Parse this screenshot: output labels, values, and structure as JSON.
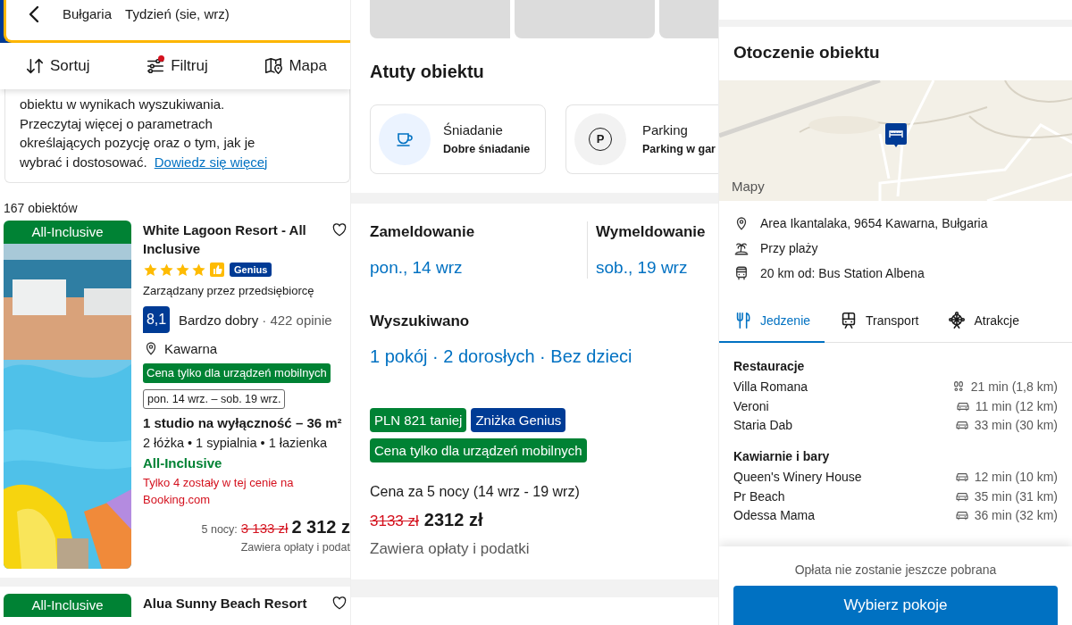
{
  "results_screen": {
    "header": {
      "destination": "Bułgaria",
      "dates": "Tydzień (sie, wrz)"
    },
    "toolbar": [
      {
        "kind": "sort",
        "label": "Sortuj",
        "alert": false
      },
      {
        "kind": "filter",
        "label": "Filtruj",
        "alert": true
      },
      {
        "kind": "map",
        "label": "Mapa",
        "alert": false
      }
    ],
    "notice": {
      "text": "obiektu w wynikach wyszukiwania. Przeczytaj więcej o parametrach określających pozycję oraz o tym, jak je wybrać i dostosować.",
      "link": "Dowiedz się więcej"
    },
    "count": "167 obiektów",
    "listings": [
      {
        "badge": "All-Inclusive",
        "title": "White Lagoon Resort - All Inclusive",
        "saved": false,
        "stars": 4,
        "preferred": true,
        "program": "Genius",
        "host": "Zarządzany przez przedsiębiorcę",
        "score": "8,1",
        "rating": "Bardzo dobry",
        "reviews": "· 422 opinie",
        "location": "Kawarna",
        "tag": "Cena tylko dla urządzeń mobilnych",
        "dates": "pon. 14 wrz. – sob. 19 wrz.",
        "room": "1 studio na wyłączność – 36 m²",
        "beds": "2 łóżka • 1 sypialnia • 1 łazienka",
        "meal": "All-Inclusive",
        "scarcity": "Tylko 4 zostały w tej cenie na Booking.com",
        "nights": "5 nocy:",
        "old_price": "3 133 zł",
        "price": "2 312 z",
        "taxes": "Zawiera opłaty i podat"
      },
      {
        "badge": "All-Inclusive",
        "title": "Alua Sunny Beach Resort",
        "saved": false
      }
    ]
  },
  "property_screen": {
    "photos": [
      {
        "kind": "placeholder"
      },
      {
        "kind": "placeholder"
      },
      {
        "kind": "placeholder"
      }
    ],
    "highlights": {
      "title": "Atuty obiektu",
      "items": [
        {
          "kind": "breakfast",
          "title": "Śniadanie",
          "detail": "Dobre śniadanie"
        },
        {
          "kind": "parking",
          "symbol": "P",
          "title": "Parking",
          "detail": "Parking w gar"
        }
      ]
    },
    "stay": {
      "checkin_label": "Zameldowanie",
      "checkin": "pon., 14 wrz",
      "checkout_label": "Wymeldowanie",
      "checkout": "sob., 19 wrz"
    },
    "search": {
      "label": "Wyszukiwano",
      "value": "1 pokój · 2 dorosłych · Bez dzieci"
    },
    "tags": [
      {
        "text": "PLN 821 taniej",
        "color": "#008234"
      },
      {
        "text": "Zniżka Genius",
        "color": "#003b95"
      },
      {
        "text": "Cena tylko dla urządzeń mobilnych",
        "color": "#008234"
      }
    ],
    "price": {
      "label": "Cena za 5 nocy (14 wrz - 19 wrz)",
      "old": "3133 zł",
      "current": "2312 zł",
      "note": "Zawiera opłaty i podatki"
    }
  },
  "surroundings_screen": {
    "title": "Otoczenie obiektu",
    "map": {
      "kind": "picture",
      "attribution": "Mapy"
    },
    "facts": [
      {
        "kind": "pin",
        "text": "Area Ikantalaka, 9654 Kawarna, Bułgaria"
      },
      {
        "kind": "beach",
        "text": "Przy plaży"
      },
      {
        "kind": "bus",
        "text": "20 km od: Bus Station Albena"
      }
    ],
    "tabs": [
      {
        "kind": "food",
        "label": "Jedzenie",
        "selected": true
      },
      {
        "kind": "transport",
        "label": "Transport",
        "selected": false
      },
      {
        "kind": "attractions",
        "label": "Atrakcje",
        "selected": false
      }
    ],
    "groups": [
      {
        "title": "Restauracje",
        "places": [
          {
            "name": "Villa Romana",
            "kind": "walk",
            "distance": "21 min (1,8 km)"
          },
          {
            "name": "Veroni",
            "kind": "car",
            "distance": "11 min (12 km)"
          },
          {
            "name": "Staria Dab",
            "kind": "car",
            "distance": "33 min (30 km)"
          }
        ]
      },
      {
        "title": "Kawiarnie i bary",
        "places": [
          {
            "name": "Queen's Winery House",
            "kind": "car",
            "distance": "12 min (10 km)"
          },
          {
            "name": "Pr Beach",
            "kind": "car",
            "distance": "35 min (31 km)"
          },
          {
            "name": "Odessa Mama",
            "kind": "car",
            "distance": "36 min (32 km)"
          }
        ]
      }
    ],
    "footer": {
      "note": "Opłata nie zostanie jeszcze pobrana",
      "button": "Wybierz pokoje"
    }
  }
}
